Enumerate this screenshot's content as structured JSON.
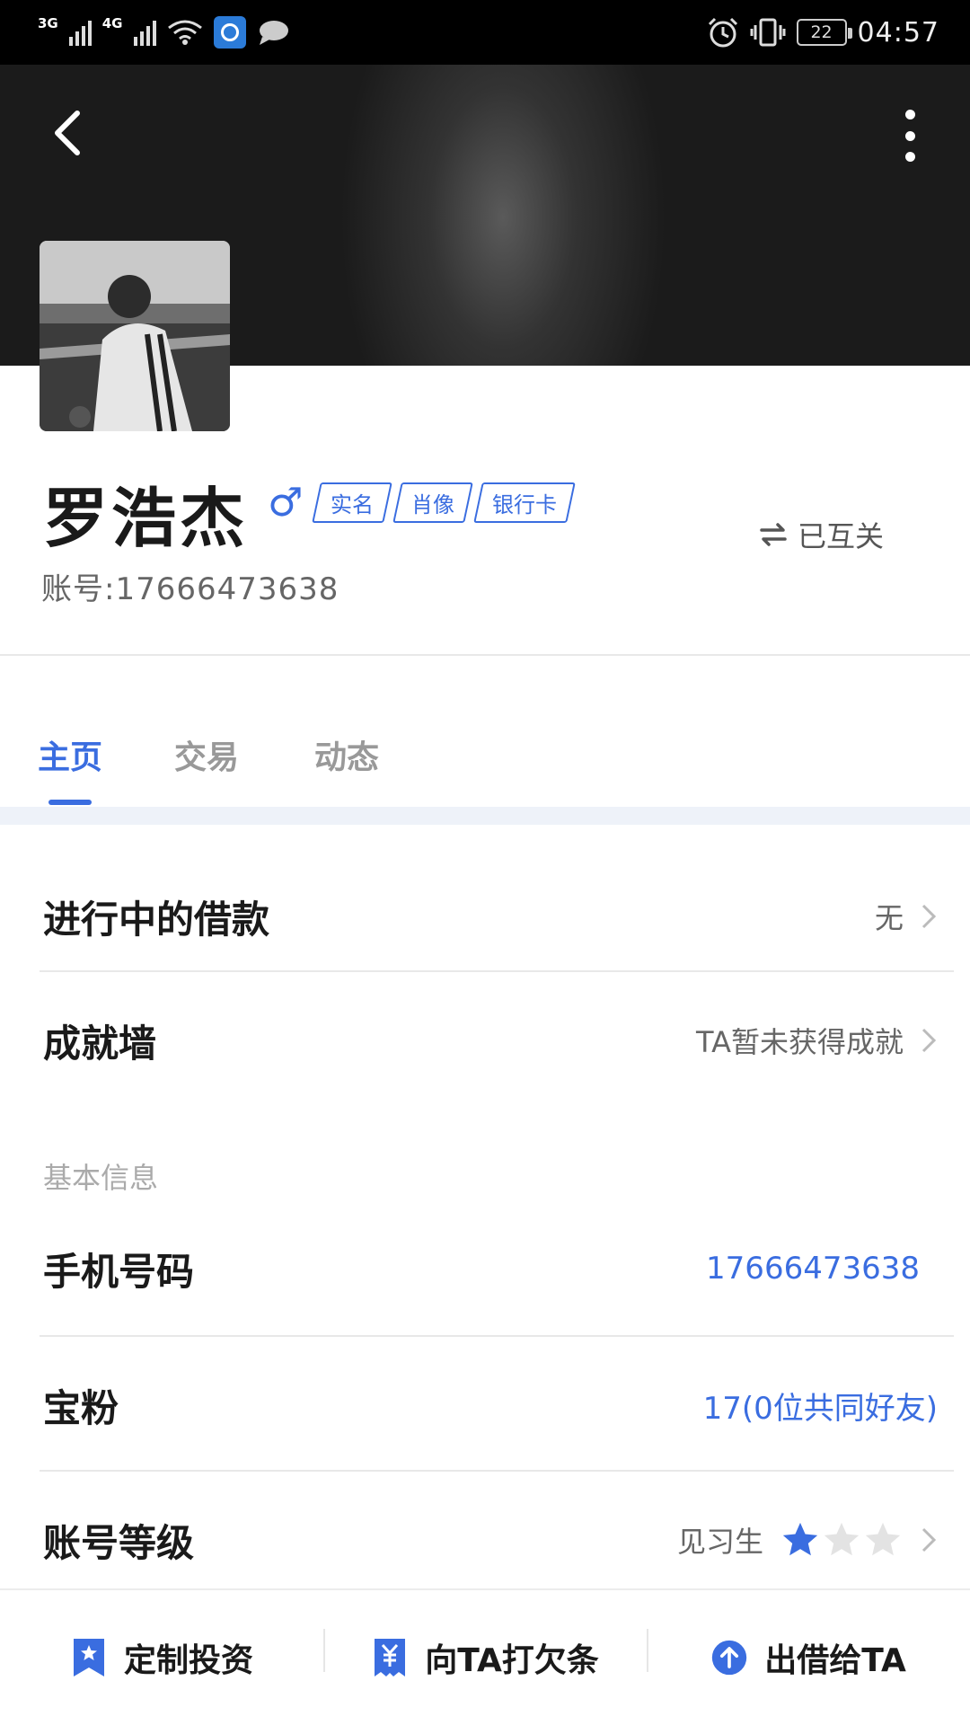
{
  "status_bar": {
    "network_1": "3G",
    "network_2": "4G",
    "battery": "22",
    "time": "04:57"
  },
  "profile": {
    "name": "罗浩杰",
    "gender_symbol": "♂",
    "tags": [
      "实名",
      "肖像",
      "银行卡"
    ],
    "relation": "已互关",
    "account": "账号:17666473638"
  },
  "tabs": [
    {
      "label": "主页",
      "active": true
    },
    {
      "label": "交易",
      "active": false
    },
    {
      "label": "动态",
      "active": false
    }
  ],
  "rows": {
    "loans": {
      "label": "进行中的借款",
      "value": "无"
    },
    "achievements": {
      "label": "成就墙",
      "value": "TA暂未获得成就"
    }
  },
  "basic_info": {
    "title": "基本信息",
    "phone": {
      "label": "手机号码",
      "value": "17666473638"
    },
    "fans": {
      "label": "宝粉",
      "value": "17(0位共同好友)"
    },
    "level": {
      "label": "账号等级",
      "value": "见习生",
      "stars_filled": 1,
      "stars_total": 3
    }
  },
  "bottom_bar": {
    "invest": "定制投资",
    "borrow": "向TA打欠条",
    "lend": "出借给TA"
  },
  "colors": {
    "accent": "#3a6de0",
    "header_dark": "#1b1b1b"
  }
}
